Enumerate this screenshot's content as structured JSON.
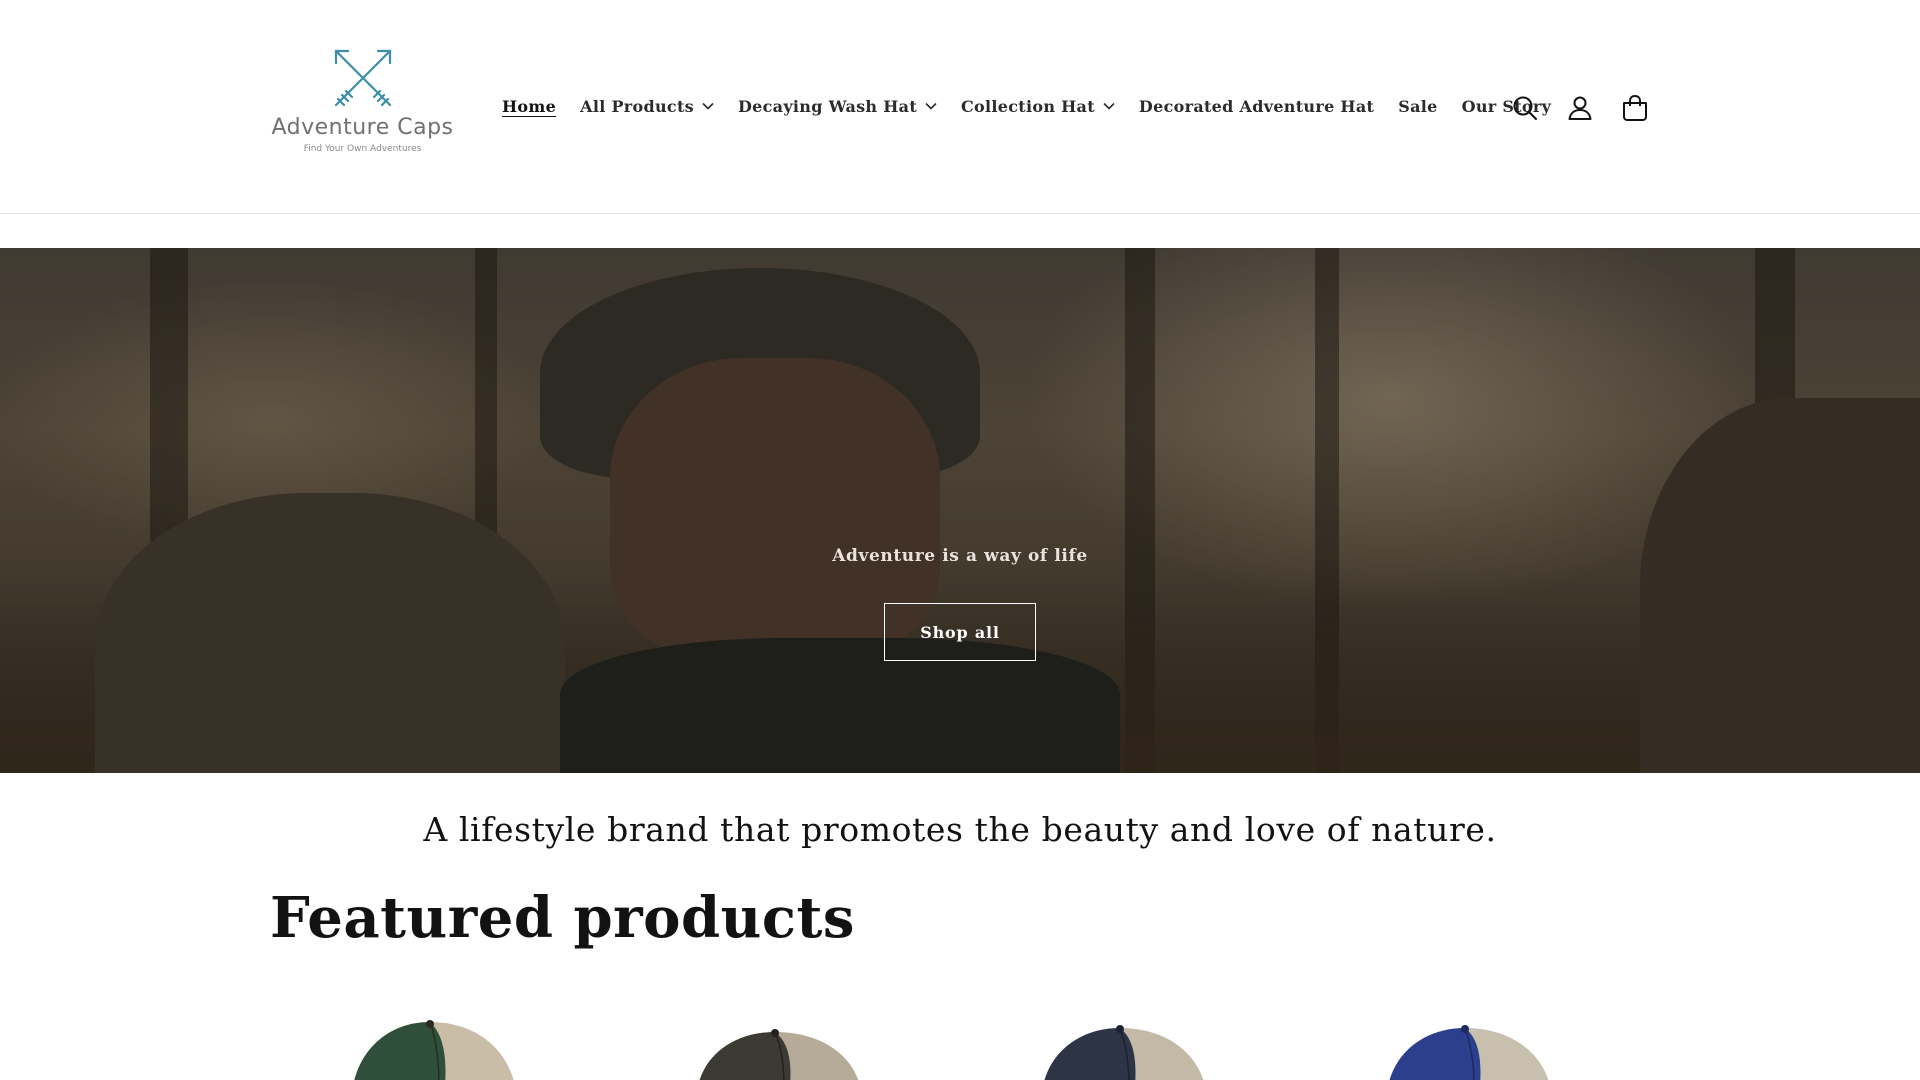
{
  "brand": {
    "name": "Adventure Caps",
    "tagline": "Find Your Own Adventures",
    "accent_color": "#3a8ea8"
  },
  "nav": {
    "items": [
      {
        "label": "Home",
        "active": true,
        "dropdown": false
      },
      {
        "label": "All Products",
        "active": false,
        "dropdown": true
      },
      {
        "label": "Decaying Wash Hat",
        "active": false,
        "dropdown": true
      },
      {
        "label": "Collection Hat",
        "active": false,
        "dropdown": true
      },
      {
        "label": "Decorated Adventure Hat",
        "active": false,
        "dropdown": false
      },
      {
        "label": "Sale",
        "active": false,
        "dropdown": false
      },
      {
        "label": "Our Story",
        "active": false,
        "dropdown": false
      }
    ]
  },
  "header_icons": [
    "search-icon",
    "account-icon",
    "cart-icon"
  ],
  "hero": {
    "subheading": "Adventure is a way of life",
    "button_label": "Shop all"
  },
  "tagline": "A lifestyle brand that promotes the beauty and love of nature.",
  "featured": {
    "title": "Featured products",
    "products": [
      {
        "front_color": "#2f4f3a",
        "mesh_color": "#c9bda8"
      },
      {
        "front_color": "#3b3a33",
        "mesh_color": "#b5ab98"
      },
      {
        "front_color": "#2c3446",
        "mesh_color": "#c4b8a6"
      },
      {
        "front_color": "#2b3f8c",
        "mesh_color": "#c8bfae"
      }
    ]
  }
}
